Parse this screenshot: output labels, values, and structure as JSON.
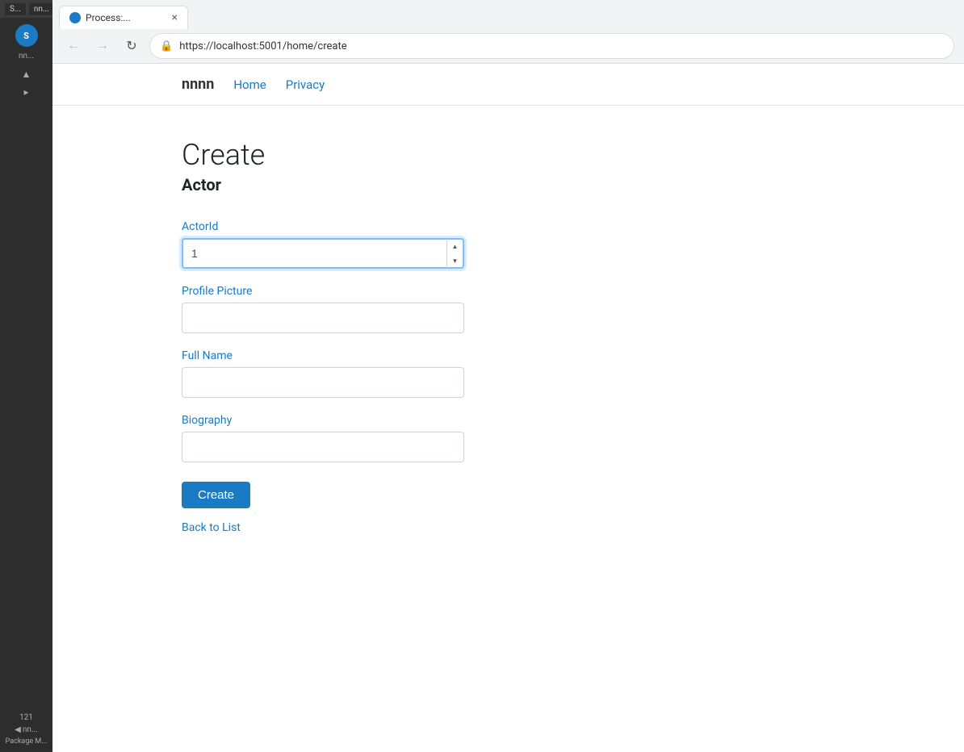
{
  "sidebar": {
    "tab_label": "S...",
    "tab_label2": "nn...",
    "circle_label": "S",
    "text1": "nn...",
    "bottom_num": "121",
    "bottom_text": "Package M..."
  },
  "browser": {
    "tab_title": "Process:...",
    "url": "https://localhost:5001/home/create",
    "url_protocol": "https://",
    "url_domain": "localhost",
    "url_port": ":5001",
    "url_path": "/home/create"
  },
  "navbar": {
    "brand": "nnnn",
    "links": [
      {
        "label": "Home",
        "href": "#"
      },
      {
        "label": "Privacy",
        "href": "#"
      }
    ]
  },
  "page": {
    "title": "Create",
    "subtitle": "Actor",
    "fields": [
      {
        "id": "actorid",
        "label": "ActorId",
        "type": "number",
        "value": "1",
        "placeholder": ""
      },
      {
        "id": "profilepicture",
        "label": "Profile Picture",
        "type": "text",
        "value": "",
        "placeholder": ""
      },
      {
        "id": "fullname",
        "label": "Full Name",
        "type": "text",
        "value": "",
        "placeholder": ""
      },
      {
        "id": "biography",
        "label": "Biography",
        "type": "text",
        "value": "",
        "placeholder": ""
      }
    ],
    "create_button": "Create",
    "back_link": "Back to List"
  }
}
